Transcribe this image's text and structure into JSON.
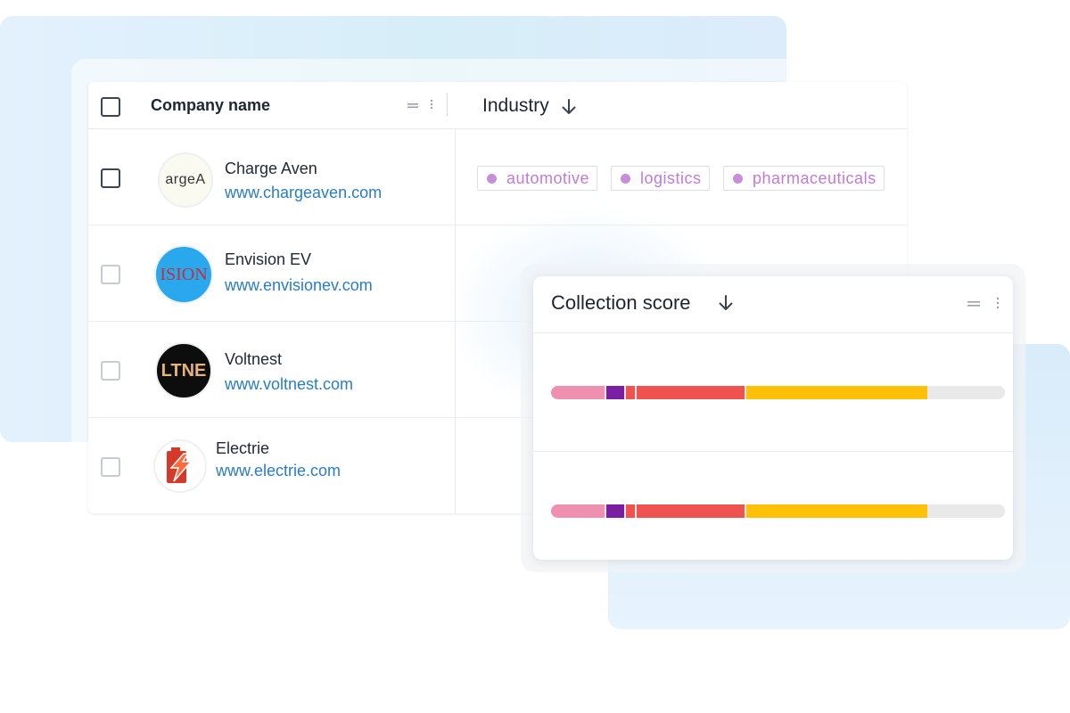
{
  "table": {
    "columns": [
      {
        "label": "Company name"
      },
      {
        "label": "Industry",
        "sort": "descending"
      }
    ],
    "rows": [
      {
        "name": "Charge Aven",
        "url": "www.chargeaven.com",
        "logo_text": "argeA",
        "industries": [
          "automotive",
          "logistics",
          "pharmaceuticals"
        ]
      },
      {
        "name": "Envision EV",
        "url": "www.envisionev.com",
        "logo_text": "ISION"
      },
      {
        "name": "Voltnest",
        "url": "www.voltnest.com",
        "logo_text": "LTNE"
      },
      {
        "name": "Electrie",
        "url": "www.electrie.com"
      }
    ]
  },
  "score_panel": {
    "title": "Collection score",
    "sort": "descending",
    "rows": [
      {
        "segments": [
          {
            "color": "#f090b0",
            "fraction": 0.122
          },
          {
            "color": "#7b1fa2",
            "fraction": 0.043
          },
          {
            "color": "#ef5350",
            "fraction": 0.024
          },
          {
            "color": "#ef5350",
            "fraction": 0.242
          },
          {
            "color": "#ffc107",
            "fraction": 0.402
          },
          {
            "color": "#e9e9ea",
            "fraction": 0.167
          }
        ]
      },
      {
        "segments": [
          {
            "color": "#f090b0",
            "fraction": 0.122
          },
          {
            "color": "#7b1fa2",
            "fraction": 0.043
          },
          {
            "color": "#ef5350",
            "fraction": 0.024
          },
          {
            "color": "#ef5350",
            "fraction": 0.242
          },
          {
            "color": "#ffc107",
            "fraction": 0.402
          },
          {
            "color": "#e9e9ea",
            "fraction": 0.167
          }
        ]
      }
    ]
  },
  "colors": {
    "link": "#2a7dc4",
    "tag_text": "#c07bd3",
    "tag_dot": "#c88ed8"
  },
  "icons": {
    "sort": "arrow-down-icon",
    "column_handle": "drag-handle-icon",
    "column_menu": "kebab-menu-icon"
  }
}
